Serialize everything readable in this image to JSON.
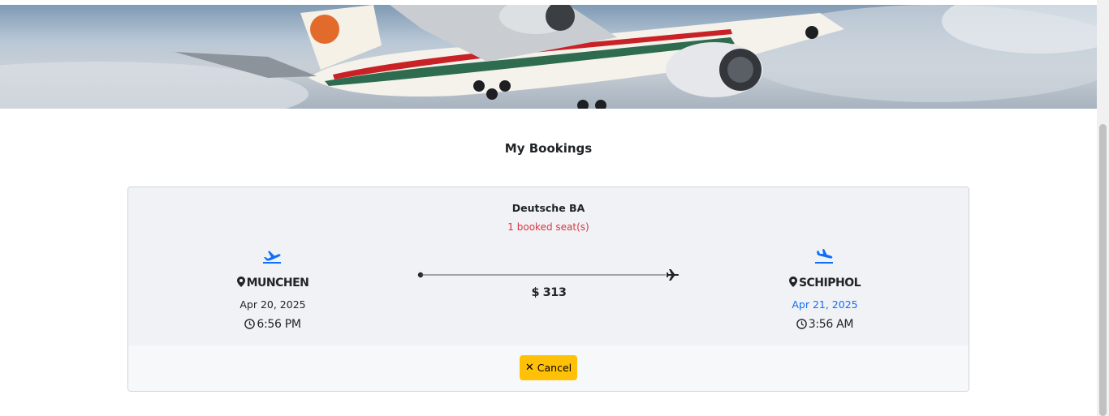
{
  "page": {
    "title": "My Bookings"
  },
  "booking": {
    "airline": "Deutsche BA",
    "seats": "1 booked seat(s)",
    "departure": {
      "city": "MUNCHEN",
      "date": "Apr 20, 2025",
      "time": "6:56 PM"
    },
    "arrival": {
      "city": "SCHIPHOL",
      "date": "Apr 21, 2025",
      "time": "3:56 AM"
    },
    "price": "$ 313",
    "cancel_label": "Cancel",
    "cancel_icon": "✕"
  },
  "colors": {
    "accent": "#0d6efd",
    "warning": "#ffc107",
    "danger": "#dc3545"
  },
  "icons": {
    "hero": "airplane-photo",
    "departure": "plane-departure-icon",
    "arrival": "plane-arrival-icon",
    "location": "map-marker-icon",
    "time": "clock-icon",
    "route": "plane-icon"
  }
}
